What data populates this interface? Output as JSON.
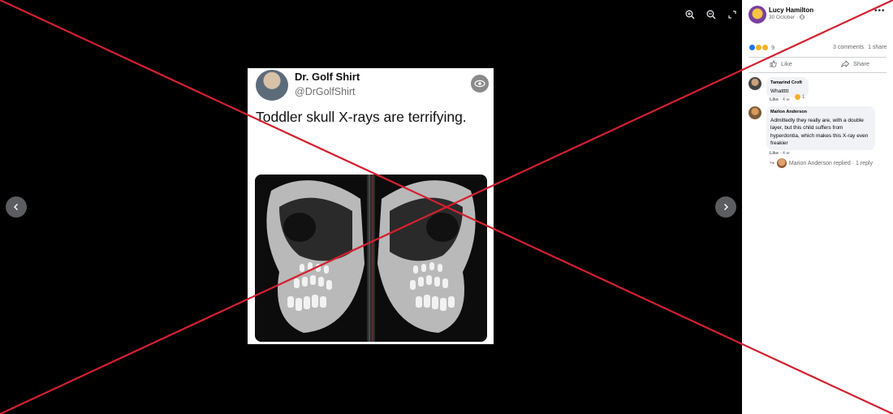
{
  "tweet": {
    "name": "Dr. Golf Shirt",
    "handle": "@DrGolfShirt",
    "text": "Toddler skull X-rays are terrifying."
  },
  "post": {
    "author": "Lucy Hamilton",
    "date": "30 October ·",
    "reaction_count": "9",
    "comments": "3 comments",
    "shares": "1 share",
    "like_label": "Like",
    "share_label": "Share"
  },
  "comments": [
    {
      "author": "Tamarind Croft",
      "text": "Whattttt",
      "like": "Like",
      "time": "· 4 w",
      "reaction_count": "1"
    },
    {
      "author": "Marion Anderson",
      "text": "Admittedly they really are, with a double layer, but this child suffers from hyperdontia, which makes this X-ray even freakier",
      "like": "Like",
      "time": "· 4 w",
      "reply_text": "Marion Anderson replied · 1 reply"
    }
  ],
  "colors": {
    "cross": "#d4202f",
    "reaction_like": "#1877f2",
    "reaction_laugh": "#f7b125",
    "reaction_wow": "#f7b125"
  }
}
